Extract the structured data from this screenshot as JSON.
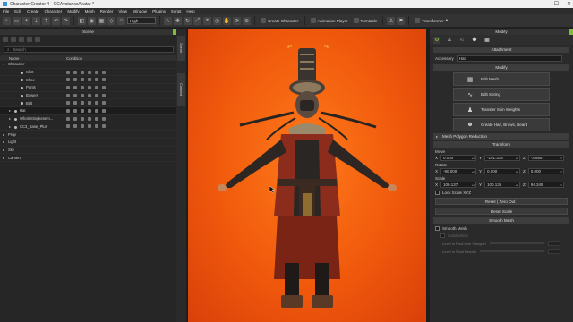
{
  "window": {
    "title": "Character Creator 4 - CCAvatar.ccAvatar *",
    "controls": [
      "–",
      "☐",
      "✕"
    ]
  },
  "menu": [
    "File",
    "Edit",
    "Create",
    "Character",
    "Modify",
    "Mesh",
    "Render",
    "View",
    "Window",
    "Plugins",
    "Script",
    "Help"
  ],
  "toolbar": {
    "quality": "High",
    "create_character": "Create Character",
    "animation_player": "Animation Player",
    "turntable": "Turntable",
    "transformer": "Transformer"
  },
  "scene": {
    "title": "Scene",
    "search_placeholder": "Search",
    "columns": {
      "name": "Name",
      "condition": "Condition"
    },
    "rows": [
      {
        "label": "Character",
        "level": 0,
        "expanded": true,
        "has_cond": false
      },
      {
        "label": "Skirt",
        "level": 2,
        "has_cond": true
      },
      {
        "label": "Shoe",
        "level": 2,
        "has_cond": true
      },
      {
        "label": "Pants",
        "level": 2,
        "has_cond": true
      },
      {
        "label": "Bowers",
        "level": 2,
        "has_cond": true
      },
      {
        "label": "Belt",
        "level": 2,
        "has_cond": true
      },
      {
        "label": "Hat",
        "level": 1,
        "has_cond": true,
        "selected": true
      },
      {
        "label": "WholeStingkesem...",
        "level": 1,
        "has_cond": true
      },
      {
        "label": "CC3_Base_Plus",
        "level": 1,
        "has_cond": true
      },
      {
        "label": "Prop",
        "level": 0,
        "has_cond": false
      },
      {
        "label": "Light",
        "level": 0,
        "has_cond": false
      },
      {
        "label": "Sky",
        "level": 0,
        "has_cond": false
      },
      {
        "label": "Camera",
        "level": 0,
        "has_cond": false
      }
    ]
  },
  "side_tabs": {
    "scene": "Scene",
    "content": "Content"
  },
  "modify": {
    "title": "Modify",
    "attachment_header": "Attachment",
    "accessory_label": "Accessory",
    "accessory_value": "Hat",
    "modify_header": "Modify",
    "buttons": [
      "Edit Mesh",
      "Edit Spring",
      "Transfer Skin Weights",
      "Create Hair, Brows, Beard"
    ],
    "mesh_polygon_reduction": "Mesh Polygon Reduction",
    "transform_header": "Transform",
    "move_label": "Move",
    "move": [
      "0.000",
      "-101.335",
      "-3.585"
    ],
    "rotate_label": "Rotate",
    "rotate": [
      "-90.000",
      "0.000",
      "0.000"
    ],
    "scale_label": "Scale",
    "scale": [
      "100.137",
      "100.135",
      "94.345"
    ],
    "lock_scale": "Lock Scale XYZ",
    "reset_zero": "Reset ( Zero Out )",
    "reset_scale": "Reset Scale",
    "smooth_mesh_header": "Smooth Mesh",
    "smooth_mesh_check": "Smooth Mesh",
    "subdivision": "Subdivision",
    "level_realtime": "Level In Real-time Viewport",
    "level_render": "Level In Final Render",
    "axis_x": "X",
    "axis_y": "Y",
    "axis_z": "Z"
  },
  "colors": {
    "accent": "#7ac231",
    "viewport_bg": "#f0590c"
  }
}
